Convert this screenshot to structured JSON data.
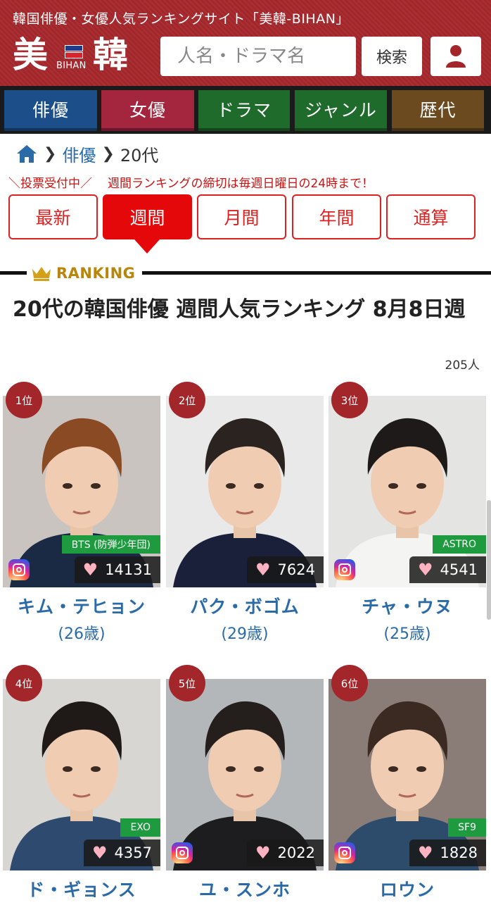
{
  "header": {
    "tagline": "韓国俳優・女優人気ランキングサイト「美韓-BIHAN」",
    "logo_char_1": "美",
    "logo_char_2": "韓",
    "logo_sub": "BIHAN",
    "search_placeholder": "人名・ドラマ名",
    "search_button": "検索",
    "user_icon": "user-icon"
  },
  "categories": [
    {
      "label": "俳優",
      "color": "#1c4f8a"
    },
    {
      "label": "女優",
      "color": "#a3263e"
    },
    {
      "label": "ドラマ",
      "color": "#1f6b2c"
    },
    {
      "label": "ジャンル",
      "color": "#1f6b2c"
    },
    {
      "label": "歴代",
      "color": "#6a4a1e"
    }
  ],
  "breadcrumb": {
    "home_icon": "home-icon",
    "level1": "俳優",
    "current": "20代"
  },
  "notice": {
    "label": "＼投票受付中／",
    "text": "週間ランキングの締切は毎週日曜日の24時まで！"
  },
  "period_tabs": [
    {
      "label": "最新",
      "active": false
    },
    {
      "label": "週間",
      "active": true
    },
    {
      "label": "月間",
      "active": false
    },
    {
      "label": "年間",
      "active": false
    },
    {
      "label": "通算",
      "active": false
    }
  ],
  "ranking": {
    "badge": "RANKING",
    "crown_icon": "crown-icon",
    "title": "20代の韓国俳優 週間人気ランキング 8月8日週",
    "count": "205人"
  },
  "cards": [
    {
      "rank": "1位",
      "name": "キム・テヒョン",
      "age": "(26歳)",
      "votes": "14131",
      "group": "BTS (防弾少年団)",
      "instagram": true,
      "bg": "#c9c4c0"
    },
    {
      "rank": "2位",
      "name": "パク・ボゴム",
      "age": "(29歳)",
      "votes": "7624",
      "group": "",
      "instagram": false,
      "bg": "#e9e9ea"
    },
    {
      "rank": "3位",
      "name": "チャ・ウヌ",
      "age": "(25歳)",
      "votes": "4541",
      "group": "ASTRO",
      "instagram": true,
      "bg": "#e4e4e2"
    },
    {
      "rank": "4位",
      "name": "ド・ギョンス",
      "age": "",
      "votes": "4357",
      "group": "EXO",
      "instagram": false,
      "bg": "#d8d6d2"
    },
    {
      "rank": "5位",
      "name": "ユ・スンホ",
      "age": "",
      "votes": "2022",
      "group": "",
      "instagram": true,
      "bg": "#b4b7ba"
    },
    {
      "rank": "6位",
      "name": "ロウン",
      "age": "",
      "votes": "1828",
      "group": "SF9",
      "instagram": true,
      "bg": "#8a7d78"
    }
  ],
  "icons": {
    "heart": "heart-icon",
    "instagram": "instagram-icon"
  },
  "colors": {
    "brand": "#a3262b",
    "active_tab": "#e4080b",
    "link": "#2a6aa6",
    "group_tag": "#1d9b3e"
  }
}
